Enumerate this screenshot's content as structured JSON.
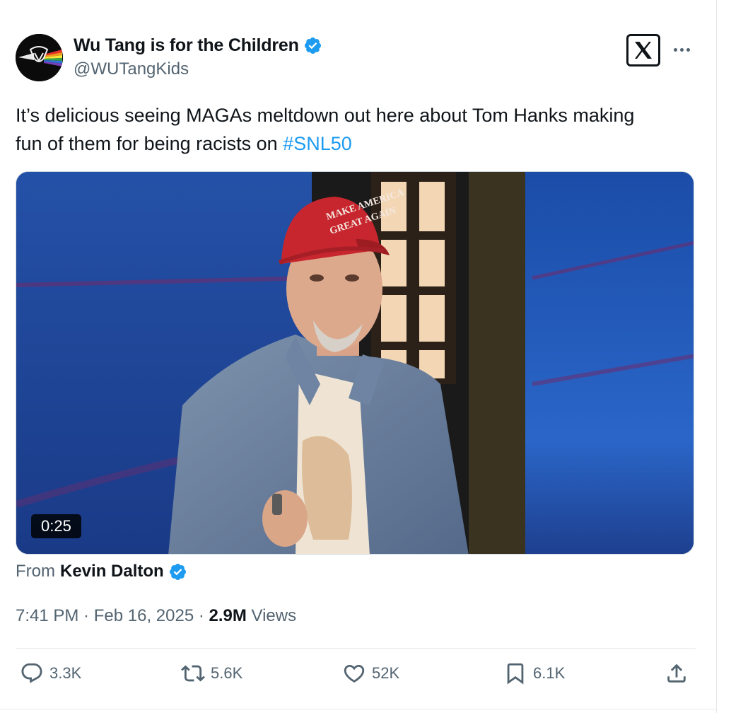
{
  "author": {
    "display_name": "Wu Tang is for the Children",
    "handle": "@WUTangKids"
  },
  "tweet": {
    "text_before": "It’s delicious seeing MAGAs meltdown out here about Tom Hanks making fun of them for being racists on ",
    "hashtag": "#SNL50"
  },
  "media": {
    "duration": "0:25",
    "hat_text_line1": "MAKE AMERICA",
    "hat_text_line2": "GREAT AGAIN"
  },
  "attribution": {
    "prefix": "From",
    "name": "Kevin Dalton"
  },
  "meta": {
    "time": "7:41 PM",
    "sep1": " · ",
    "date": "Feb 16, 2025",
    "sep2": " · ",
    "views_count": "2.9M",
    "views_label": " Views"
  },
  "actions": {
    "replies": "3.3K",
    "reposts": "5.6K",
    "likes": "52K",
    "bookmarks": "6.1K"
  },
  "colors": {
    "link": "#1d9bf0",
    "secondary_text": "#536471",
    "verified": "#1d9bf0"
  },
  "icons": [
    "verified-badge-icon",
    "x-logo-icon",
    "more-icon",
    "reply-icon",
    "repost-icon",
    "like-icon",
    "bookmark-icon",
    "share-icon"
  ]
}
